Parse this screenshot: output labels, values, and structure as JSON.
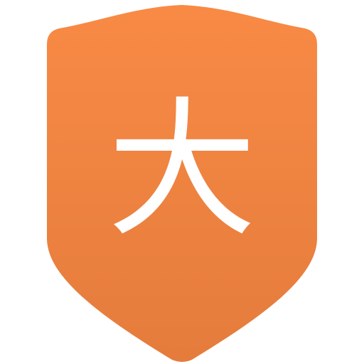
{
  "icon": {
    "name": "shield-icon",
    "character": "大",
    "colors": {
      "shield_top": "#F88A45",
      "shield_bottom": "#E57C3C",
      "glyph": "#FFFFFF",
      "background": "#FFFFFF"
    }
  }
}
